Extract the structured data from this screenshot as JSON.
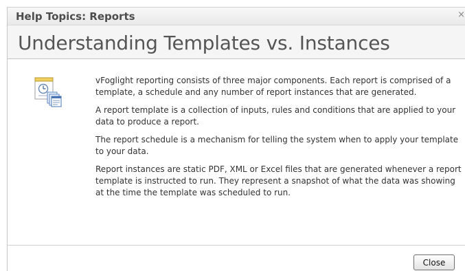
{
  "window": {
    "title": "Help Topics: Reports",
    "close_glyph": "×"
  },
  "page": {
    "heading": "Understanding Templates vs. Instances",
    "icon": "report-template-icon"
  },
  "content": {
    "paragraphs": [
      "vFoglight reporting consists of three major components. Each report is comprised of a template, a schedule and any number of report instances that are generated.",
      "A report template is a collection of inputs, rules and conditions that are applied to your data to produce a report.",
      "The report schedule is a mechanism for telling the system when to apply your template to your data.",
      "Report instances are static PDF, XML or Excel files that are generated whenever a report template is instructed to run. They represent a snapshot of what the data was showing at the time the template was scheduled to run."
    ]
  },
  "footer": {
    "close_label": "Close"
  }
}
